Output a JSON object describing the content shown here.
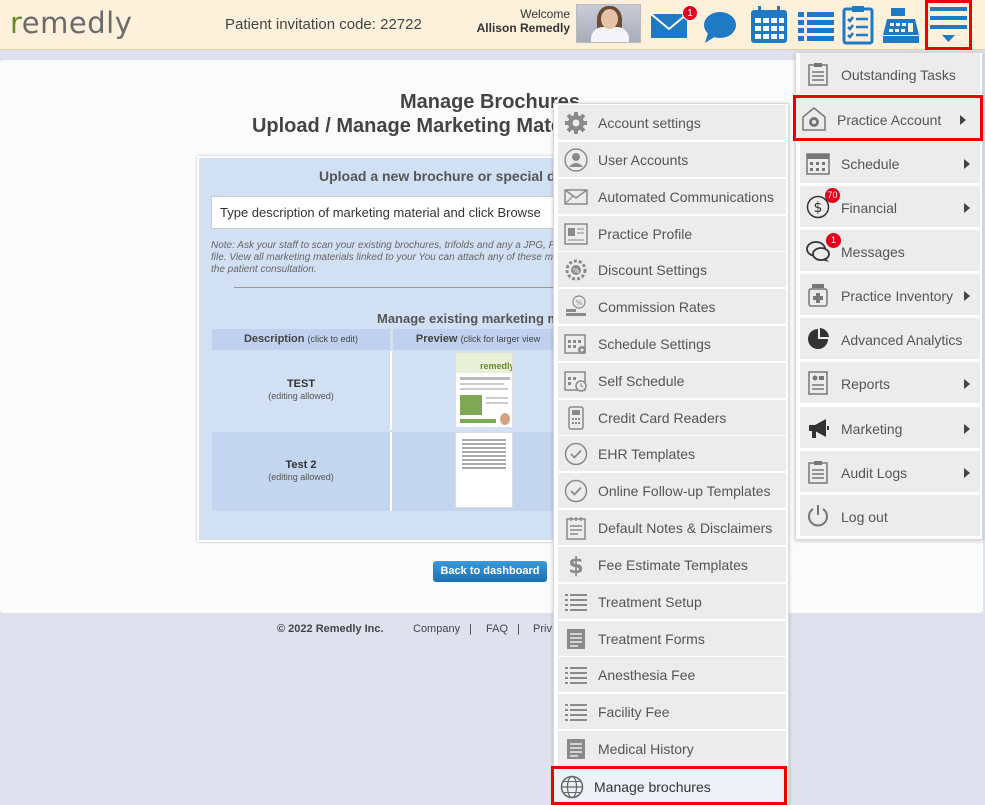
{
  "header": {
    "logo_text": "emedly",
    "logo_r": "r",
    "invitation": "Patient invitation code: 22722",
    "welcome": "Welcome",
    "user_name": "Allison Remedly",
    "messages_badge": "1"
  },
  "main": {
    "title1": "Manage Brochures",
    "title2": "Upload / Manage Marketing Materials an",
    "panel_title": "Upload a new brochure or special dea",
    "input_placeholder": "Type description of marketing material and click Browse",
    "note": "Note: Ask your staff to scan your existing brochures, trifolds and any a JPG, PNG, or PDF file. View all marketing materials linked to your You can attach any of these materials to the patient consultation.",
    "manage_title": "Manage existing marketing m",
    "col_desc": "Description",
    "col_desc_hint": "(click to edit)",
    "col_preview": "Preview",
    "col_preview_hint": "(click for larger view",
    "rows": [
      {
        "name": "TEST",
        "note": "(editing allowed)"
      },
      {
        "name": "Test 2",
        "note": "(editing allowed)"
      }
    ],
    "back_button": "Back to dashboard"
  },
  "footer": {
    "copyright": "© 2022 Remedly Inc.",
    "company": "Company",
    "faq": "FAQ",
    "privacy": "Priv",
    "sep": "|"
  },
  "main_menu": [
    {
      "label": "Outstanding Tasks",
      "icon": "clipboard-icon",
      "arrow": false
    },
    {
      "label": "Practice Account",
      "icon": "gear-house-icon",
      "arrow": true,
      "highlight": true
    },
    {
      "label": "Schedule",
      "icon": "calendar-icon",
      "arrow": true
    },
    {
      "label": "Financial",
      "icon": "dollar-icon",
      "arrow": true,
      "badge": "70"
    },
    {
      "label": "Messages",
      "icon": "chat-icon",
      "arrow": false,
      "badge": "1"
    },
    {
      "label": "Practice Inventory",
      "icon": "medicine-icon",
      "arrow": true
    },
    {
      "label": "Advanced Analytics",
      "icon": "pie-chart-icon",
      "arrow": false
    },
    {
      "label": "Reports",
      "icon": "report-icon",
      "arrow": true
    },
    {
      "label": "Marketing",
      "icon": "megaphone-icon",
      "arrow": true
    },
    {
      "label": "Audit Logs",
      "icon": "log-icon",
      "arrow": true
    },
    {
      "label": "Log out",
      "icon": "power-icon",
      "arrow": false
    }
  ],
  "sub_menu": [
    {
      "label": "Account settings",
      "icon": "gear-icon"
    },
    {
      "label": "User Accounts",
      "icon": "user-icon"
    },
    {
      "label": "Automated Communications",
      "icon": "envelope-icon"
    },
    {
      "label": "Practice Profile",
      "icon": "profile-card-icon"
    },
    {
      "label": "Discount Settings",
      "icon": "discount-gear-icon"
    },
    {
      "label": "Commission Rates",
      "icon": "coins-icon"
    },
    {
      "label": "Schedule Settings",
      "icon": "calendar-gear-icon"
    },
    {
      "label": "Self Schedule",
      "icon": "calendar-clock-icon"
    },
    {
      "label": "Credit Card Readers",
      "icon": "card-reader-icon"
    },
    {
      "label": "EHR Templates",
      "icon": "check-circle-icon"
    },
    {
      "label": "Online Follow-up Templates",
      "icon": "check-circle-icon"
    },
    {
      "label": "Default Notes & Disclaimers",
      "icon": "notes-icon"
    },
    {
      "label": "Fee Estimate Templates",
      "icon": "dollar-sign-icon"
    },
    {
      "label": "Treatment Setup",
      "icon": "list-icon"
    },
    {
      "label": "Treatment Forms",
      "icon": "form-icon"
    },
    {
      "label": "Anesthesia Fee",
      "icon": "list-icon"
    },
    {
      "label": "Facility Fee",
      "icon": "list-icon"
    },
    {
      "label": "Medical History",
      "icon": "form-icon"
    },
    {
      "label": "Manage brochures",
      "icon": "globe-icon",
      "highlight": true
    }
  ],
  "colors": {
    "accent_blue": "#1f6fb4",
    "highlight_red": "#e00000",
    "header_bg": "#fdf1dc"
  }
}
